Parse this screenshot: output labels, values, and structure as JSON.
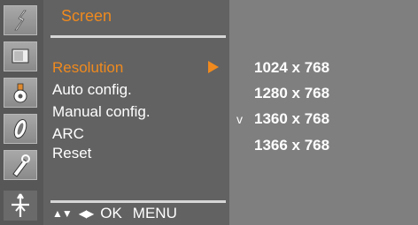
{
  "sidebar": {
    "icons": [
      {
        "name": "picture-icon"
      },
      {
        "name": "sound-icon"
      },
      {
        "name": "time-icon"
      },
      {
        "name": "option-icon"
      },
      {
        "name": "lock-icon"
      },
      {
        "name": "screen-icon"
      }
    ],
    "selected": "screen-icon"
  },
  "menu": {
    "title": "Screen",
    "items": [
      {
        "label": "Resolution",
        "active": true
      },
      {
        "label": "Auto config."
      },
      {
        "label": "Manual config."
      },
      {
        "label": "ARC"
      },
      {
        "label": "Reset"
      }
    ],
    "footer": {
      "updown_symbol": "▲▼",
      "leftright_symbol": "◀▶",
      "ok_label": "OK",
      "menu_label": "MENU"
    }
  },
  "submenu": {
    "options": [
      "1024 x 768",
      "1280 x 768",
      "1360 x 768",
      "1366 x 768"
    ],
    "selected_index": 2,
    "check_mark": "v"
  },
  "colors": {
    "accent": "#f08a1e",
    "menu_bg": "#626262",
    "sidebar_bg": "#575757",
    "submenu_bg": "#7f7f7f"
  }
}
